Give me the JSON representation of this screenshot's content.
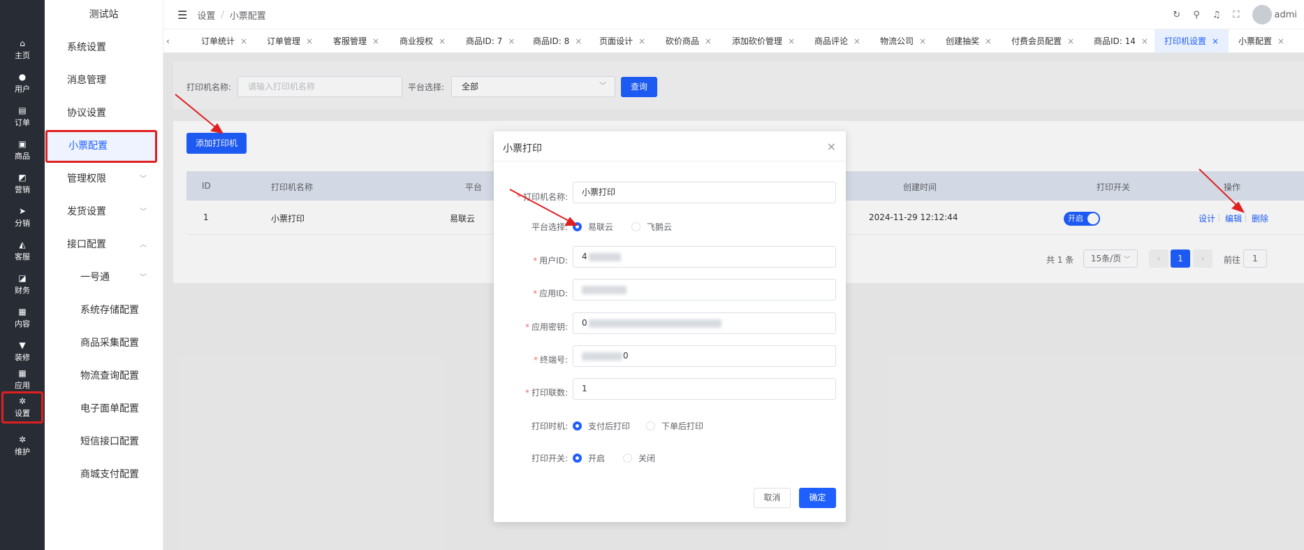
{
  "site_title": "测试站",
  "rail": [
    {
      "label": "主页",
      "icon": "home-icon",
      "glyph": "⌂"
    },
    {
      "label": "用户",
      "icon": "user-icon",
      "glyph": "●"
    },
    {
      "label": "订单",
      "icon": "order-icon",
      "glyph": "▤"
    },
    {
      "label": "商品",
      "icon": "goods-icon",
      "glyph": "▣"
    },
    {
      "label": "营销",
      "icon": "marketing-icon",
      "glyph": "◩"
    },
    {
      "label": "分销",
      "icon": "distribution-icon",
      "glyph": "➤"
    },
    {
      "label": "客服",
      "icon": "service-icon",
      "glyph": "◭"
    },
    {
      "label": "财务",
      "icon": "finance-icon",
      "glyph": "◪"
    },
    {
      "label": "内容",
      "icon": "content-icon",
      "glyph": "▦"
    },
    {
      "label": "装修",
      "icon": "decorate-icon",
      "glyph": "▼"
    },
    {
      "label": "应用",
      "icon": "apps-icon",
      "glyph": "▦"
    },
    {
      "label": "设置",
      "icon": "settings-icon",
      "glyph": "✲"
    },
    {
      "label": "维护",
      "icon": "maintain-icon",
      "glyph": "✲"
    }
  ],
  "submenu": [
    {
      "label": "系统设置"
    },
    {
      "label": "消息管理"
    },
    {
      "label": "协议设置"
    },
    {
      "label": "小票配置"
    },
    {
      "label": "管理权限",
      "chev": "﹀"
    },
    {
      "label": "发货设置",
      "chev": "﹀"
    },
    {
      "label": "接口配置",
      "chev": "︿"
    },
    {
      "label": "一号通",
      "chev": "﹀"
    },
    {
      "label": "系统存储配置"
    },
    {
      "label": "商品采集配置"
    },
    {
      "label": "物流查询配置"
    },
    {
      "label": "电子面单配置"
    },
    {
      "label": "短信接口配置"
    },
    {
      "label": "商城支付配置"
    }
  ],
  "breadcrumb": {
    "first": "设置",
    "sep": "/",
    "current": "小票配置",
    "menu_glyph": "☰"
  },
  "header_icons": {
    "refresh": "↻",
    "search": "⚲",
    "bell": "♫",
    "fullscreen": "⛶",
    "user": "admi"
  },
  "tabs_nav": "‹",
  "tabs": [
    {
      "label": "订单统计"
    },
    {
      "label": "订单管理"
    },
    {
      "label": "客服管理"
    },
    {
      "label": "商业授权"
    },
    {
      "label": "商品ID: 7"
    },
    {
      "label": "商品ID: 8"
    },
    {
      "label": "页面设计"
    },
    {
      "label": "砍价商品"
    },
    {
      "label": "添加砍价管理"
    },
    {
      "label": "商品评论"
    },
    {
      "label": "物流公司"
    },
    {
      "label": "创建抽奖"
    },
    {
      "label": "付费会员配置"
    },
    {
      "label": "商品ID: 14"
    },
    {
      "label": "打印机设置"
    },
    {
      "label": "小票配置"
    }
  ],
  "tab_close": "×",
  "search": {
    "name_label": "打印机名称:",
    "name_placeholder": "请输入打印机名称",
    "platform_label": "平台选择:",
    "platform_value": "全部",
    "query_button": "查询"
  },
  "add_button": "添加打印机",
  "table": {
    "headers": [
      "ID",
      "打印机名称",
      "平台",
      "创建时间",
      "打印开关",
      "操作"
    ],
    "rows": [
      {
        "id": "1",
        "name": "小票打印",
        "platform": "易联云",
        "created": "2024-11-29 12:12:44",
        "switch_label": "开启",
        "actions": [
          "设计",
          "编辑",
          "删除"
        ]
      }
    ]
  },
  "pagination": {
    "total": "共 1 条",
    "page_size": "15条/页",
    "current": "1",
    "goto_label": "前往",
    "goto_value": "1",
    "prev": "‹",
    "next": "›"
  },
  "dialog": {
    "title": "小票打印",
    "close": "×",
    "fields": {
      "printer_name": {
        "label": "打印机名称:",
        "value": "小票打印"
      },
      "platform": {
        "label": "平台选择:",
        "options": [
          "易联云",
          "飞鹅云"
        ],
        "selected": "易联云"
      },
      "user_id": {
        "label": "用户ID:",
        "value": "4"
      },
      "app_id": {
        "label": "应用ID:",
        "value": ""
      },
      "app_secret": {
        "label": "应用密钥:",
        "value": "0"
      },
      "terminal": {
        "label": "终端号:",
        "value": "0"
      },
      "copies": {
        "label": "打印联数:",
        "value": "1"
      },
      "print_timing": {
        "label": "打印时机:",
        "options": [
          "支付后打印",
          "下单后打印"
        ],
        "selected": "支付后打印"
      },
      "print_switch": {
        "label": "打印开关:",
        "options": [
          "开启",
          "关闭"
        ],
        "selected": "开启"
      }
    },
    "cancel": "取消",
    "confirm": "确定"
  },
  "colors": {
    "primary": "#1f5fff",
    "annotation": "#e02020",
    "rail": "#282c34"
  }
}
